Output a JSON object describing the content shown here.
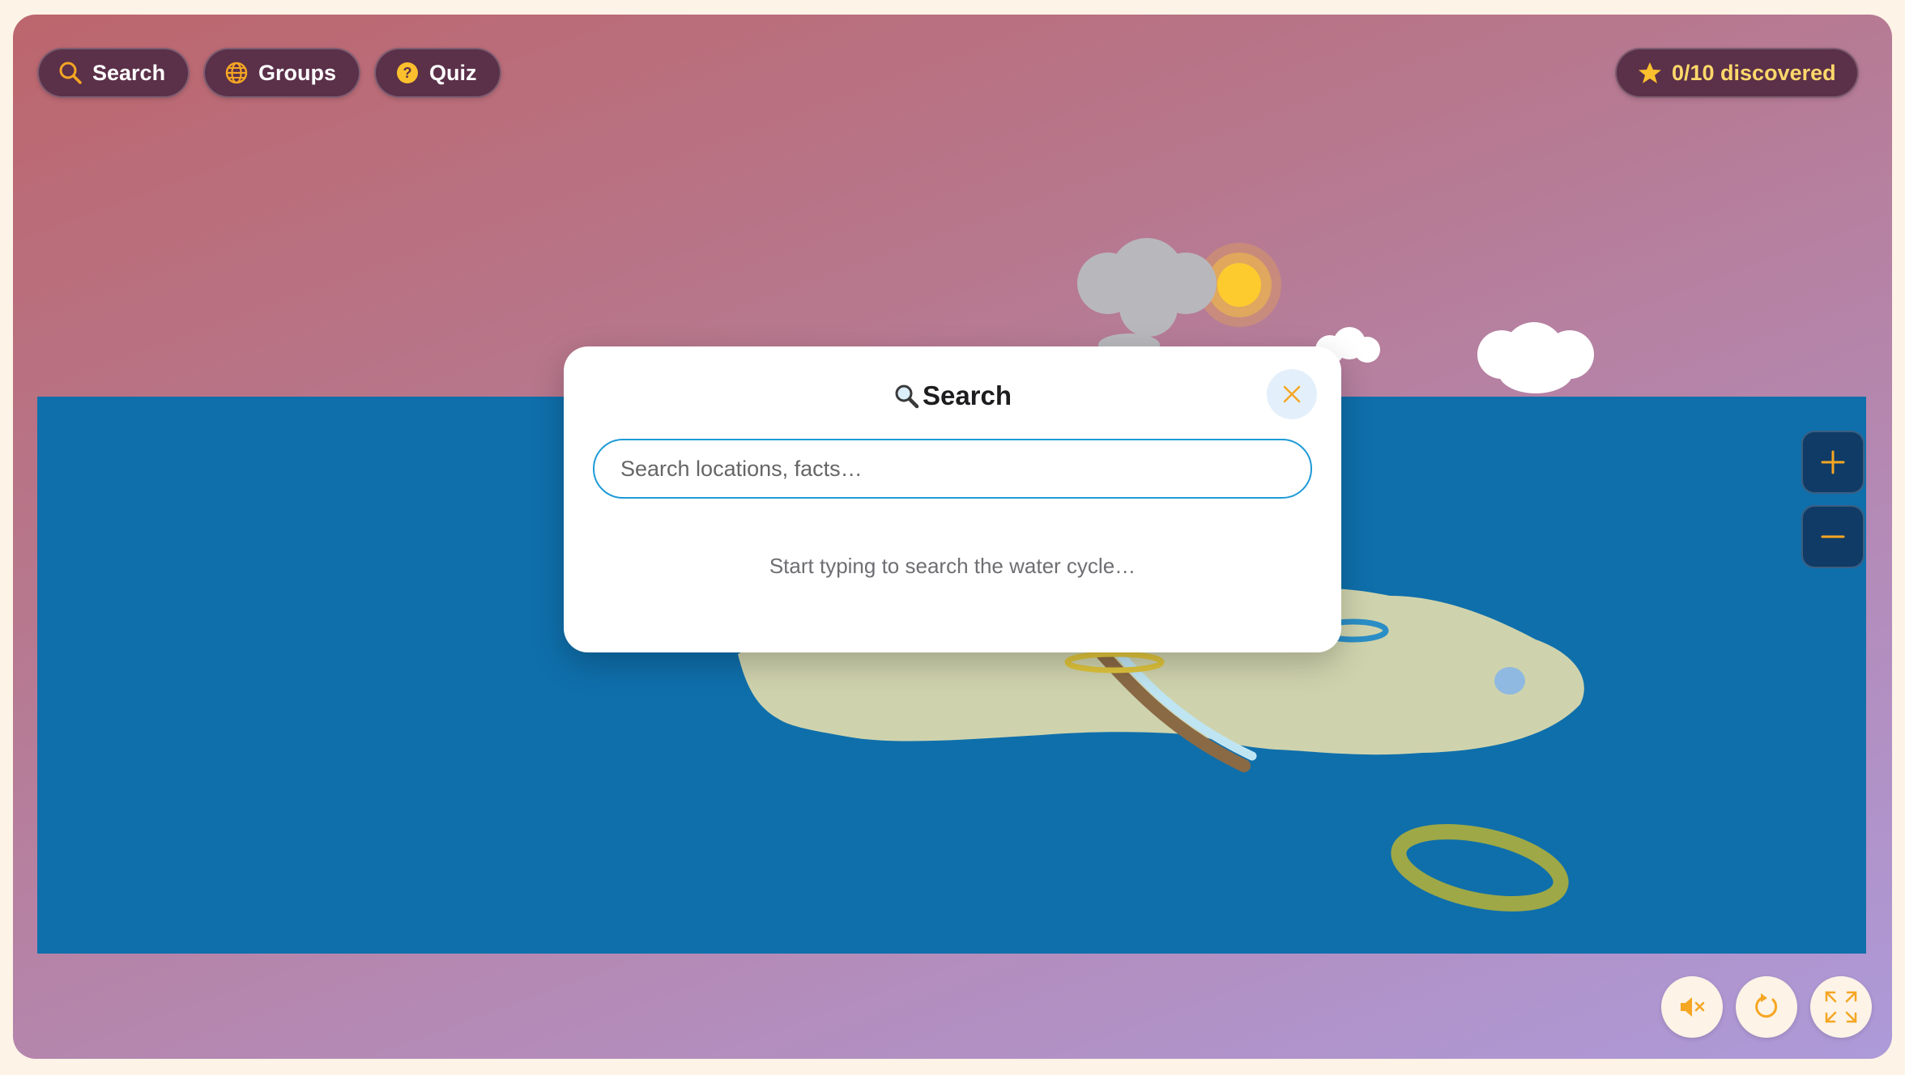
{
  "toolbar": {
    "search_label": "Search",
    "groups_label": "Groups",
    "quiz_label": "Quiz"
  },
  "discovery": {
    "label": "0/10 discovered",
    "found": 0,
    "total": 10
  },
  "search_modal": {
    "title": "Search",
    "title_icon": "magnifier-emoji-icon",
    "placeholder": "Search locations, facts…",
    "value": "",
    "hint": "Start typing to search the water cycle…"
  },
  "zoom_controls": {
    "zoom_in": "plus-icon",
    "zoom_out": "minus-icon"
  },
  "bottom_controls": [
    "mute-icon",
    "reset-view-icon",
    "fullscreen-icon"
  ],
  "colors": {
    "accent": "#f5a623",
    "pill_bg": "#5b3049",
    "counter_text": "#ffd86b",
    "ocean": "#0f6fab",
    "land": "#cfd3ad",
    "input_border": "#1e9ad6",
    "zoom_bg": "#0f3b66"
  }
}
